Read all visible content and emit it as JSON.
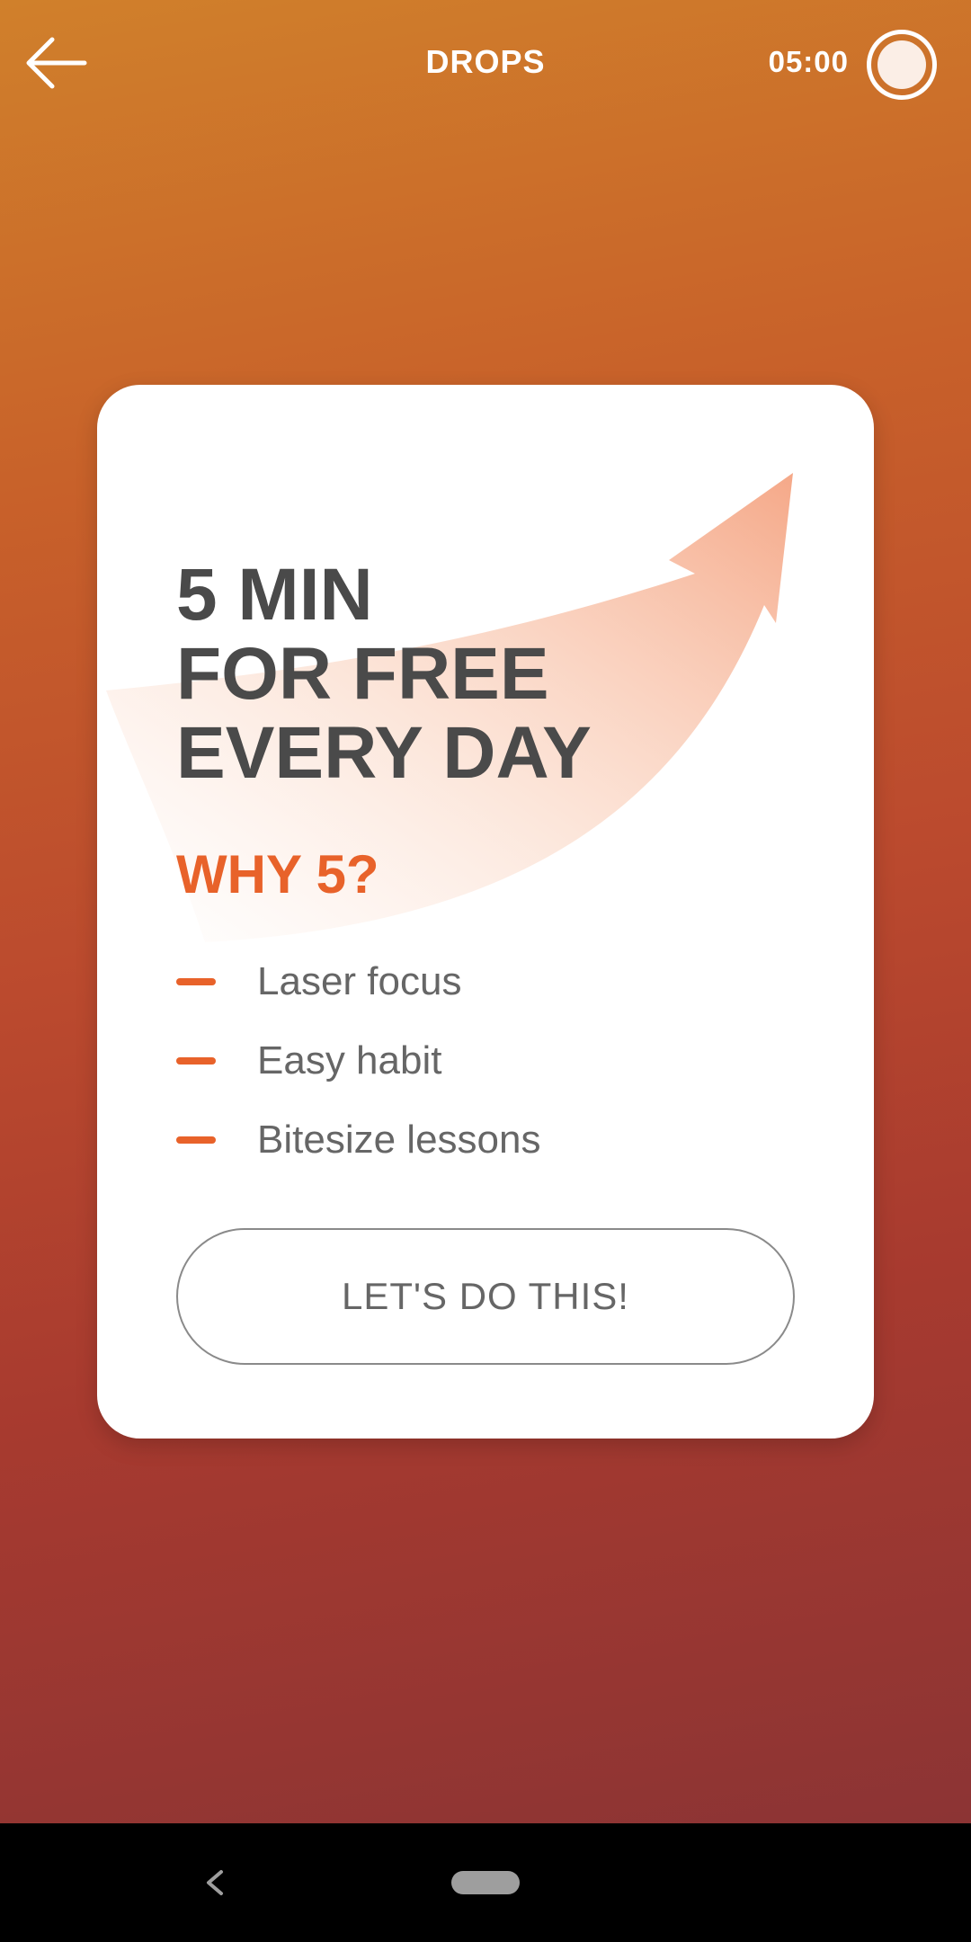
{
  "header": {
    "title": "DROPS",
    "timer": "05:00",
    "back_icon": "arrow-left-icon",
    "timer_icon": "timer-circle-icon"
  },
  "card": {
    "headline_lines": [
      "5 MIN",
      "FOR FREE",
      "EVERY DAY"
    ],
    "why_title": "WHY 5?",
    "reasons": [
      "Laser focus",
      "Easy habit",
      "Bitesize lessons"
    ],
    "cta_label": "LET'S DO THIS!",
    "decor_icon": "growth-arrow-icon"
  },
  "navbar": {
    "back_icon": "nav-back-icon",
    "home_icon": "nav-home-pill-icon"
  },
  "colors": {
    "accent": "#e8622a",
    "headline": "#4a4a4a",
    "body_text": "#666666",
    "card": "#ffffff",
    "background_top": "#d0802b",
    "background_bottom": "#8c3434"
  }
}
